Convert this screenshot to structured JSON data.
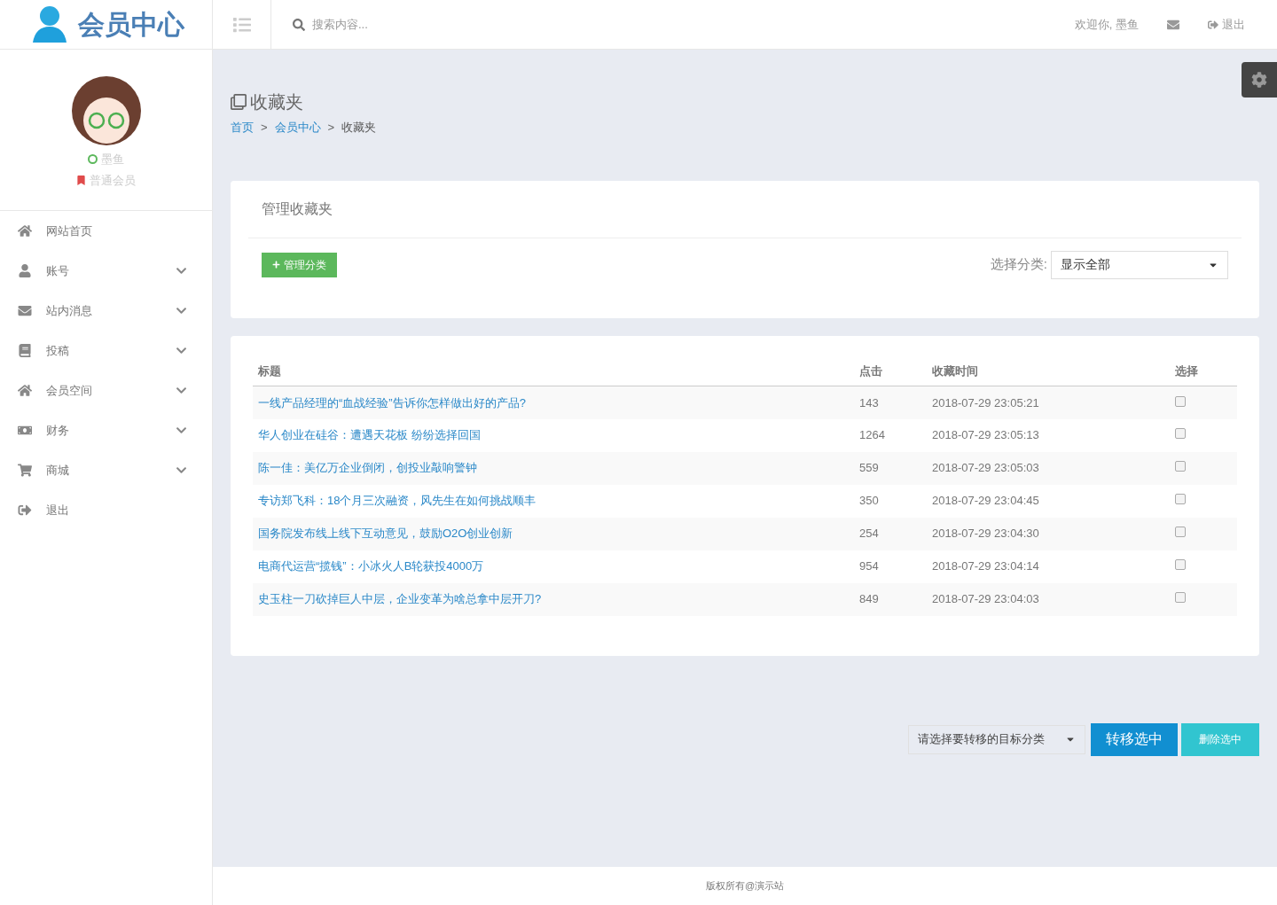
{
  "header": {
    "logo": "会员中心",
    "search": {
      "placeholder": "搜索内容..."
    },
    "welcome": "欢迎你, 墨鱼",
    "logout": "退出"
  },
  "profile": {
    "name": "墨鱼",
    "online": true,
    "level": "普通会员"
  },
  "sidebar": {
    "items": [
      {
        "label": "网站首页",
        "has_submenu": false
      },
      {
        "label": "账号",
        "has_submenu": true
      },
      {
        "label": "站内消息",
        "has_submenu": true
      },
      {
        "label": "投稿",
        "has_submenu": true
      },
      {
        "label": "会员空间",
        "has_submenu": true
      },
      {
        "label": "财务",
        "has_submenu": true
      },
      {
        "label": "商城",
        "has_submenu": true
      },
      {
        "label": "退出",
        "has_submenu": false
      }
    ]
  },
  "page": {
    "title": "收藏夹",
    "separator": ">",
    "breadcrumb": [
      {
        "label": "首页",
        "link": true
      },
      {
        "label": "会员中心",
        "link": true
      },
      {
        "label": "收藏夹",
        "link": false
      }
    ]
  },
  "manage_panel": {
    "title": "管理收藏夹",
    "add_button": "管理分类",
    "filter_label": "选择分类:",
    "filter_value": "显示全部"
  },
  "table": {
    "columns": [
      "标题",
      "点击",
      "收藏时间",
      "选择"
    ],
    "rows": [
      {
        "title": "一线产品经理的“血战经验”告诉你怎样做出好的产品?",
        "clicks": "143",
        "time": "2018-07-29 23:05:21",
        "checked": false
      },
      {
        "title": "华人创业在硅谷：遭遇天花板 纷纷选择回国",
        "clicks": "1264",
        "time": "2018-07-29 23:05:13",
        "checked": false
      },
      {
        "title": "陈一佳：美亿万企业倒闭，创投业敲响警钟",
        "clicks": "559",
        "time": "2018-07-29 23:05:03",
        "checked": false
      },
      {
        "title": "专访郑飞科：18个月三次融资，风先生在如何挑战顺丰",
        "clicks": "350",
        "time": "2018-07-29 23:04:45",
        "checked": false
      },
      {
        "title": "国务院发布线上线下互动意见，鼓励O2O创业创新",
        "clicks": "254",
        "time": "2018-07-29 23:04:30",
        "checked": false
      },
      {
        "title": "电商代运营“揽钱”：小冰火人B轮获投4000万",
        "clicks": "954",
        "time": "2018-07-29 23:04:14",
        "checked": false
      },
      {
        "title": "史玉柱一刀砍掉巨人中层，企业变革为啥总拿中层开刀?",
        "clicks": "849",
        "time": "2018-07-29 23:04:03",
        "checked": false
      }
    ]
  },
  "actions": {
    "move_select": "请选择要转移的目标分类",
    "move_button": "转移选中",
    "delete_button": "删除选中"
  },
  "footer": "版权所有@演示站"
}
